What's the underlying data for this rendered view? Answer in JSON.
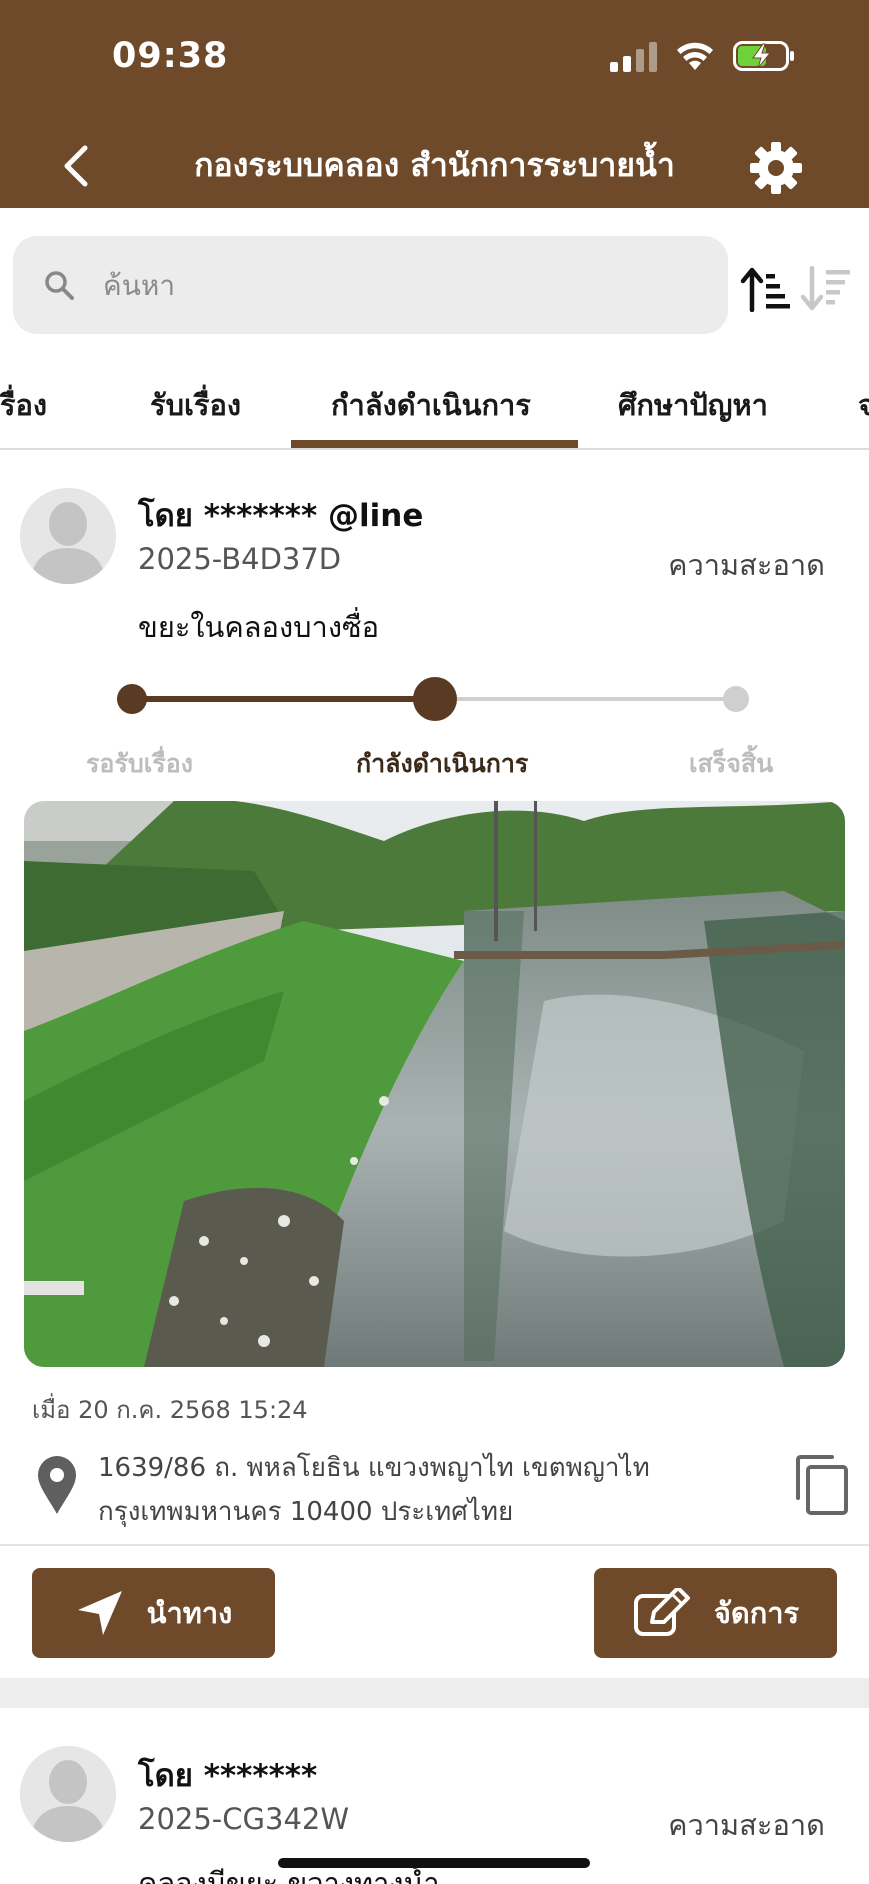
{
  "status_bar": {
    "time": "09:38"
  },
  "header": {
    "title": "กองระบบคลอง สำนักการระบายน้ำ"
  },
  "search": {
    "placeholder": "ค้นหา"
  },
  "tabs": [
    {
      "label": "เรื่อง"
    },
    {
      "label": "รับเรื่อง"
    },
    {
      "label": "กำลังดำเนินการ",
      "active": true
    },
    {
      "label": "ศึกษาปัญหา"
    },
    {
      "label": "จ"
    }
  ],
  "card": {
    "by": "โดย ******* @line",
    "code": "2025-B4D37D",
    "category": "ความสะอาด",
    "description": "ขยะในคลองบางซื่อ",
    "steps": [
      {
        "label": "รอรับเรื่อง",
        "color": "#bdbdbd"
      },
      {
        "label": "กำลังดำเนินการ",
        "color": "#3a2a1a"
      },
      {
        "label": "เสร็จสิ้น",
        "color": "#bdbdbd"
      }
    ],
    "date": "เมื่อ 20 ก.ค. 2568 15:24",
    "address_line1": "1639/86 ถ. พหลโยธิน แขวงพญาไท เขตพญาไท",
    "address_line2": "กรุงเทพมหานคร 10400 ประเทศไทย",
    "navigate_label": "นำทาง",
    "manage_label": "จัดการ"
  },
  "card2": {
    "by": "โดย *******",
    "code": "2025-CG342W",
    "category": "ความสะอาด",
    "description": "คลองมีขยะ ขวางทางน้ำ"
  },
  "colors": {
    "brand": "#6e4a2a",
    "accent_dark": "#5a3a22"
  }
}
